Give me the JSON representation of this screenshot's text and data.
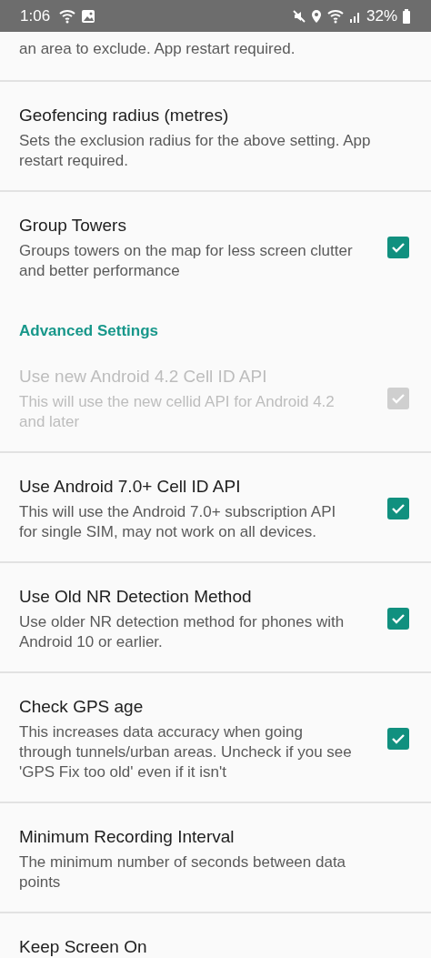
{
  "status_bar": {
    "time": "1:06",
    "battery": "32%"
  },
  "items": [
    {
      "kind": "plain",
      "summary": "an area to exclude. App restart required.",
      "disabled": false
    },
    {
      "kind": "plain",
      "title": "Geofencing radius (metres)",
      "summary": "Sets the exclusion radius for the above setting. App restart required.",
      "disabled": false
    },
    {
      "kind": "checkbox",
      "title": "Group Towers",
      "summary": "Groups towers on the map for less screen clutter and better performance",
      "checked": true,
      "disabled": false
    },
    {
      "kind": "header",
      "title": "Advanced Settings"
    },
    {
      "kind": "checkbox",
      "title": "Use new Android 4.2 Cell ID API",
      "summary": "This will use the new cellid API for Android 4.2 and later",
      "checked": true,
      "disabled": true
    },
    {
      "kind": "checkbox",
      "title": "Use Android 7.0+ Cell ID API",
      "summary": "This will use the Android 7.0+ subscription API for single SIM, may not work on all devices.",
      "checked": true,
      "disabled": false
    },
    {
      "kind": "checkbox",
      "title": "Use Old NR Detection Method",
      "summary": "Use older NR detection method for phones with Android 10 or earlier.",
      "checked": true,
      "disabled": false
    },
    {
      "kind": "checkbox",
      "title": "Check GPS age",
      "summary": "This increases data accuracy when going through tunnels/urban areas. Uncheck if you see 'GPS Fix too old' even if it isn't",
      "checked": true,
      "disabled": false
    },
    {
      "kind": "plain",
      "title": "Minimum Recording Interval",
      "summary": "The minimum number of seconds between data points",
      "disabled": false
    },
    {
      "kind": "plain",
      "title": "Keep Screen On",
      "disabled": false
    }
  ]
}
